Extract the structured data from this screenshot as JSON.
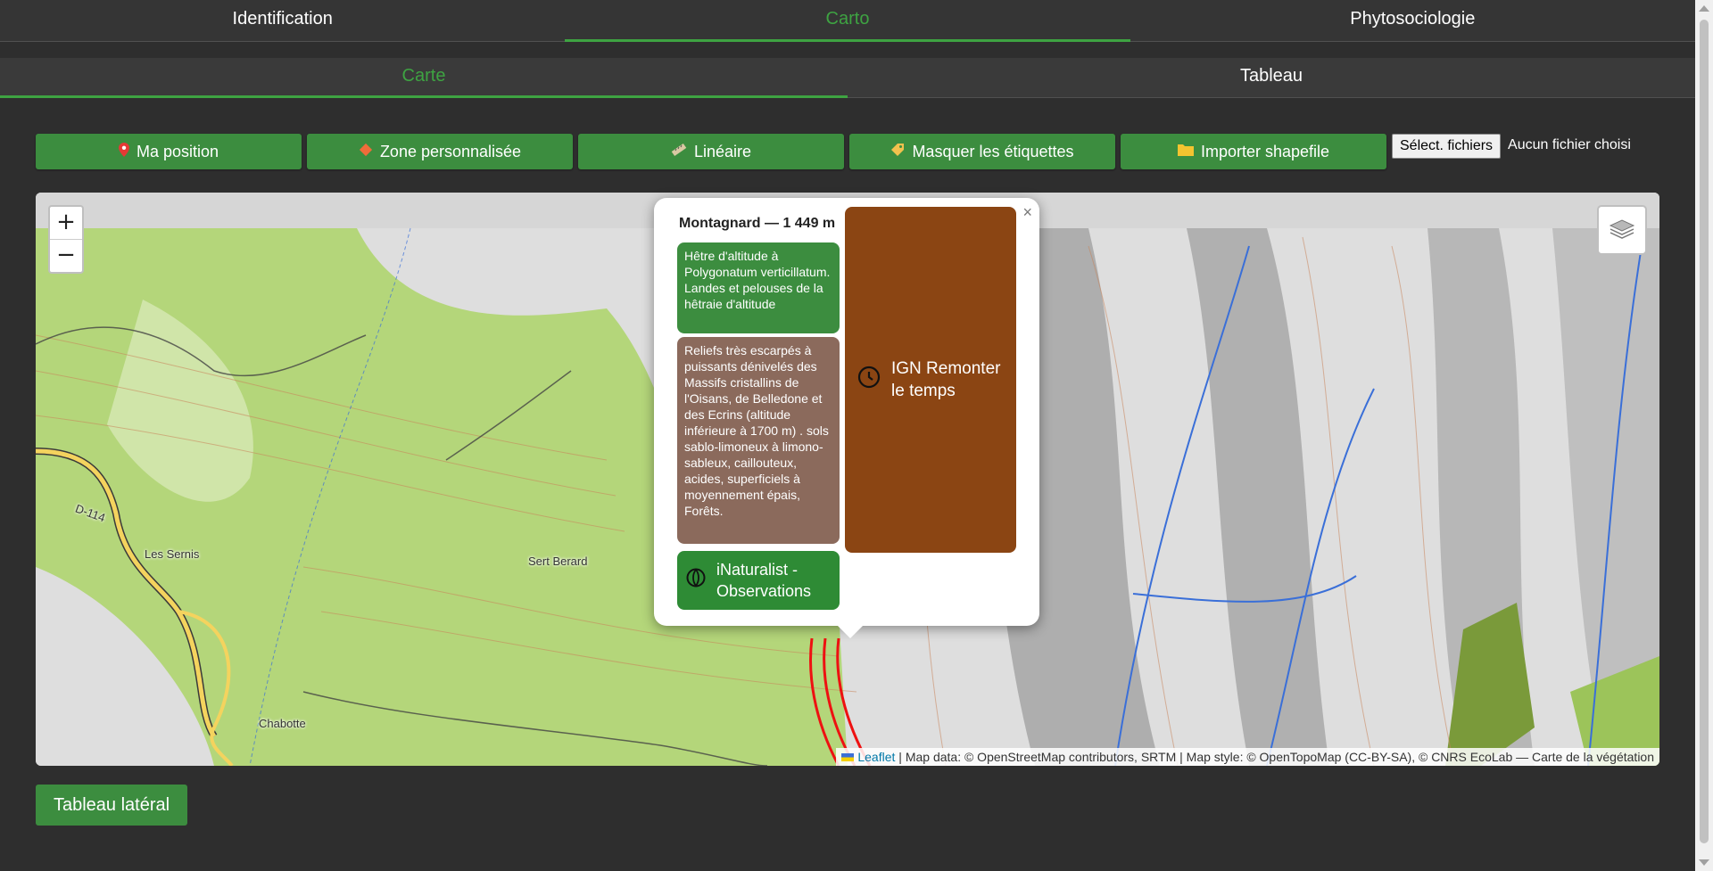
{
  "tabs_main": [
    {
      "label": "Identification",
      "active": false
    },
    {
      "label": "Carto",
      "active": true
    },
    {
      "label": "Phytosociologie",
      "active": false
    }
  ],
  "tabs_sub": [
    {
      "label": "Carte",
      "active": true
    },
    {
      "label": "Tableau",
      "active": false
    }
  ],
  "toolbar": {
    "ma_position": "Ma position",
    "zone": "Zone personnalisée",
    "lineaire": "Linéaire",
    "masquer": "Masquer les étiquettes",
    "importer": "Importer shapefile",
    "file_button": "Sélect. fichiers",
    "file_status": "Aucun fichier choisi",
    "icons": [
      "pin-icon",
      "diamond-icon",
      "ruler-icon",
      "tag-icon",
      "folder-icon"
    ]
  },
  "map": {
    "zoom_in": "+",
    "zoom_out": "−",
    "places": {
      "les_sernis": "Les Sernis",
      "sert_berard": "Sert Berard",
      "chabotte": "Chabotte",
      "d114": "D-114"
    },
    "attribution": {
      "leaflet": "Leaflet",
      "rest": "| Map data: © OpenStreetMap contributors, SRTM | Map style: © OpenTopoMap (CC-BY-SA), © CNRS EcoLab — Carte de la végétation"
    },
    "colors": {
      "forest": "#b4d67a",
      "slope": "#c9c9c9",
      "river": "#3a6fd8",
      "contour": "#c9845a",
      "road": "#f4d35e"
    }
  },
  "popup": {
    "close": "×",
    "title": "Montagnard — 1 449 m",
    "veg_text": "Hêtre d'altitude à Polygonatum verticillatum. Landes et pelouses de la hêtraie d'altitude",
    "soil_text": "Reliefs très escarpés à puissants dénivelés des Massifs cristallins de l'Oisans, de Belledone et des Ecrins (altitude inférieure à 1700 m) . sols sablo-limoneux à limono-sableux, caillouteux, acides, superficiels à moyennement épais, Forêts.",
    "inat": "iNaturalist - Observations",
    "ign": "IGN Remonter le temps",
    "colors": {
      "veg": "#3c8d3f",
      "soil": "#8b6a5c",
      "inat": "#2e8b35",
      "ign": "#8b4513"
    }
  },
  "bottom": {
    "tableau_lateral": "Tableau latéral"
  }
}
